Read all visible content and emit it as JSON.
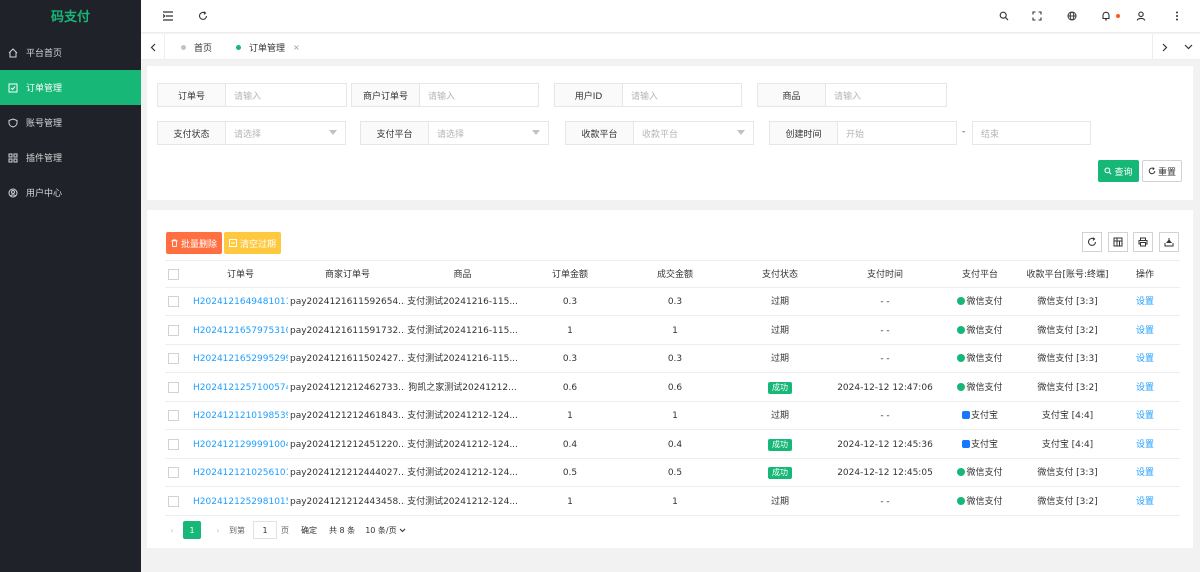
{
  "app": {
    "logo": "码支付"
  },
  "sidebar": {
    "items": [
      {
        "label": "平台首页",
        "icon": "home-icon"
      },
      {
        "label": "订单管理",
        "icon": "order-icon",
        "active": true
      },
      {
        "label": "账号管理",
        "icon": "shield-icon"
      },
      {
        "label": "插件管理",
        "icon": "plugin-icon"
      },
      {
        "label": "用户中心",
        "icon": "user-icon"
      }
    ]
  },
  "tabs": [
    {
      "label": "首页"
    },
    {
      "label": "订单管理",
      "close": "×"
    }
  ],
  "search": {
    "order_no": {
      "label": "订单号",
      "placeholder": "请输入"
    },
    "merchant_order_no": {
      "label": "商户订单号",
      "placeholder": "请输入"
    },
    "user_id": {
      "label": "用户ID",
      "placeholder": "请输入"
    },
    "goods": {
      "label": "商品",
      "placeholder": "请输入"
    },
    "pay_status": {
      "label": "支付状态",
      "placeholder": "请选择"
    },
    "pay_platform": {
      "label": "支付平台",
      "placeholder": "请选择"
    },
    "collect_platform": {
      "label": "收款平台",
      "placeholder": "收款平台"
    },
    "create_time": {
      "label": "创建时间",
      "start": "开始",
      "dash": "-",
      "end": "结束"
    },
    "query_label": "查询",
    "reset_label": "重置"
  },
  "toolbar": {
    "batch_delete": "批量删除",
    "clear_expired": "清空过期"
  },
  "table": {
    "columns": [
      "订单号",
      "商家订单号",
      "商品",
      "订单金额",
      "成交金额",
      "支付状态",
      "支付时间",
      "支付平台",
      "收款平台[账号:终端]",
      "操作"
    ],
    "rows": [
      {
        "order_no": "H2024121649481011",
        "merchant_no": "pay2024121611592654...",
        "goods": "支付测试20241216-115...",
        "amount": "0.3",
        "deal": "0.3",
        "status": "过期",
        "success": false,
        "pay_time": "- -",
        "platform": "微信支付",
        "platform_type": "wechat",
        "collect": "微信支付 [3:3]",
        "action": "设置"
      },
      {
        "order_no": "H2024121657975310",
        "merchant_no": "pay2024121611591732...",
        "goods": "支付测试20241216-115...",
        "amount": "1",
        "deal": "1",
        "status": "过期",
        "success": false,
        "pay_time": "- -",
        "platform": "微信支付",
        "platform_type": "wechat",
        "collect": "微信支付 [3:2]",
        "action": "设置"
      },
      {
        "order_no": "H2024121652995299",
        "merchant_no": "pay2024121611502427...",
        "goods": "支付测试20241216-115...",
        "amount": "0.3",
        "deal": "0.3",
        "status": "过期",
        "success": false,
        "pay_time": "- -",
        "platform": "微信支付",
        "platform_type": "wechat",
        "collect": "微信支付 [3:3]",
        "action": "设置"
      },
      {
        "order_no": "H2024121257100574",
        "merchant_no": "pay2024121212462733...",
        "goods": "狗凯之家测试20241212...",
        "amount": "0.6",
        "deal": "0.6",
        "status": "成功",
        "success": true,
        "pay_time": "2024-12-12 12:47:06",
        "platform": "微信支付",
        "platform_type": "wechat",
        "collect": "微信支付 [3:2]",
        "action": "设置"
      },
      {
        "order_no": "H2024121210198539",
        "merchant_no": "pay2024121212461843...",
        "goods": "支付测试20241212-124...",
        "amount": "1",
        "deal": "1",
        "status": "过期",
        "success": false,
        "pay_time": "- -",
        "platform": "支付宝",
        "platform_type": "alipay",
        "collect": "支付宝 [4:4]",
        "action": "设置"
      },
      {
        "order_no": "H2024121299991004",
        "merchant_no": "pay2024121212451220...",
        "goods": "支付测试20241212-124...",
        "amount": "0.4",
        "deal": "0.4",
        "status": "成功",
        "success": true,
        "pay_time": "2024-12-12 12:45:36",
        "platform": "支付宝",
        "platform_type": "alipay",
        "collect": "支付宝 [4:4]",
        "action": "设置"
      },
      {
        "order_no": "H2024121210256101",
        "merchant_no": "pay2024121212444027...",
        "goods": "支付测试20241212-124...",
        "amount": "0.5",
        "deal": "0.5",
        "status": "成功",
        "success": true,
        "pay_time": "2024-12-12 12:45:05",
        "platform": "微信支付",
        "platform_type": "wechat",
        "collect": "微信支付 [3:3]",
        "action": "设置"
      },
      {
        "order_no": "H2024121252981015",
        "merchant_no": "pay2024121212443458...",
        "goods": "支付测试20241212-124...",
        "amount": "1",
        "deal": "1",
        "status": "过期",
        "success": false,
        "pay_time": "- -",
        "platform": "微信支付",
        "platform_type": "wechat",
        "collect": "微信支付 [3:2]",
        "action": "设置"
      }
    ]
  },
  "pagination": {
    "prev": "‹",
    "current": "1",
    "next": "›",
    "goto": "到第",
    "page_value": "1",
    "page_unit": "页",
    "confirm": "确定",
    "total": "共 8 条",
    "per_page": "10 条/页"
  },
  "colors": {
    "accent": "#16b777",
    "link": "#1e9fff",
    "danger": "#ff5722",
    "warn": "#ffb800",
    "sidebar": "#20222a"
  }
}
